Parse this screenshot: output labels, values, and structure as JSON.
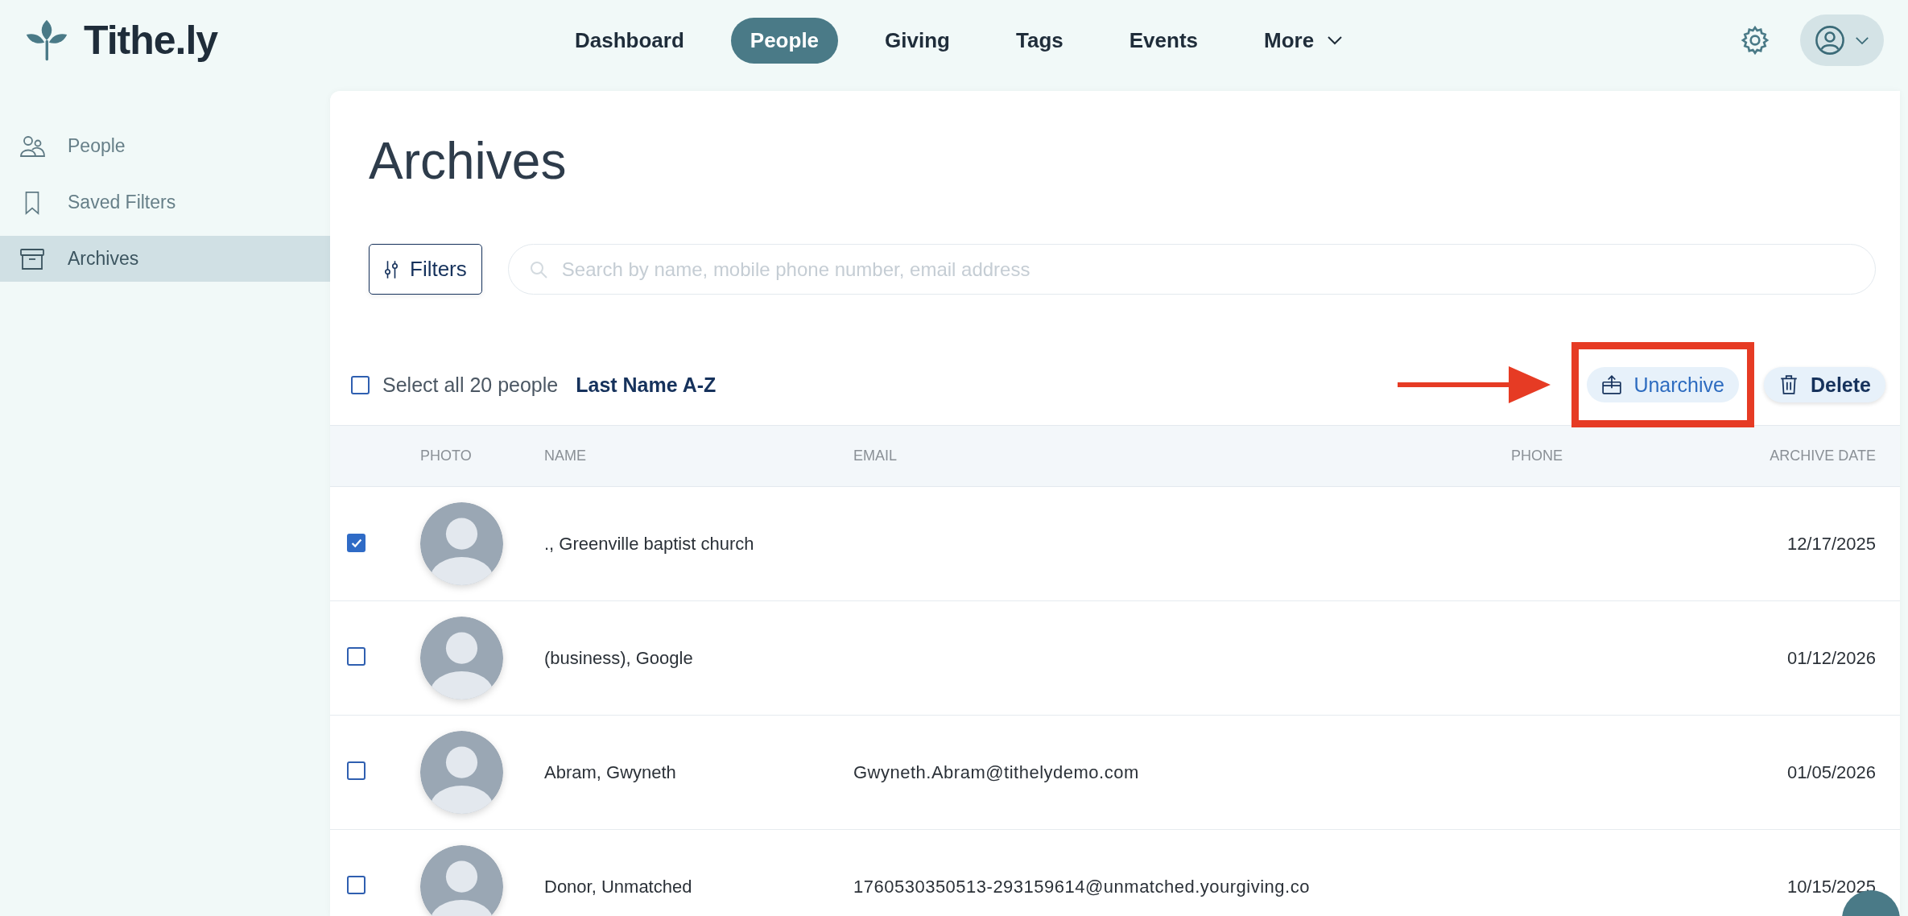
{
  "brand": {
    "name": "Tithe.ly"
  },
  "nav": [
    {
      "label": "Dashboard",
      "selected": false
    },
    {
      "label": "People",
      "selected": true
    },
    {
      "label": "Giving",
      "selected": false
    },
    {
      "label": "Tags",
      "selected": false
    },
    {
      "label": "Events",
      "selected": false
    },
    {
      "label": "More",
      "selected": false
    }
  ],
  "sidebar": {
    "items": [
      {
        "label": "People",
        "kind": "people",
        "selected": false
      },
      {
        "label": "Saved Filters",
        "kind": "bookmark",
        "selected": false
      },
      {
        "label": "Archives",
        "kind": "archive",
        "selected": true
      }
    ]
  },
  "page": {
    "title": "Archives"
  },
  "filters_button": "Filters",
  "search": {
    "placeholder": "Search by name, mobile phone number, email address"
  },
  "toolbar": {
    "select_all": {
      "label": "Select all 20 people",
      "checked": false
    },
    "sort": "Last Name A-Z",
    "actions": [
      {
        "label": "Unarchive",
        "kind": "unarchive",
        "highlighted": true
      },
      {
        "label": "Delete",
        "kind": "delete",
        "highlighted": false
      }
    ]
  },
  "table": {
    "columns": [
      "PHOTO",
      "NAME",
      "EMAIL",
      "PHONE",
      "ARCHIVE DATE"
    ],
    "rows": [
      {
        "selected": true,
        "name": "., Greenville baptist church",
        "email": "",
        "phone": "",
        "archive_date": "12/17/2025"
      },
      {
        "selected": false,
        "name": "(business), Google",
        "email": "",
        "phone": "",
        "archive_date": "01/12/2026"
      },
      {
        "selected": false,
        "name": "Abram, Gwyneth",
        "email": "Gwyneth.Abram@tithelydemo.com",
        "phone": "",
        "archive_date": "01/05/2026"
      },
      {
        "selected": false,
        "name": "Donor, Unmatched",
        "email": "1760530350513-293159614@unmatched.yourgiving.co",
        "phone": "",
        "archive_date": "10/15/2025"
      }
    ]
  }
}
